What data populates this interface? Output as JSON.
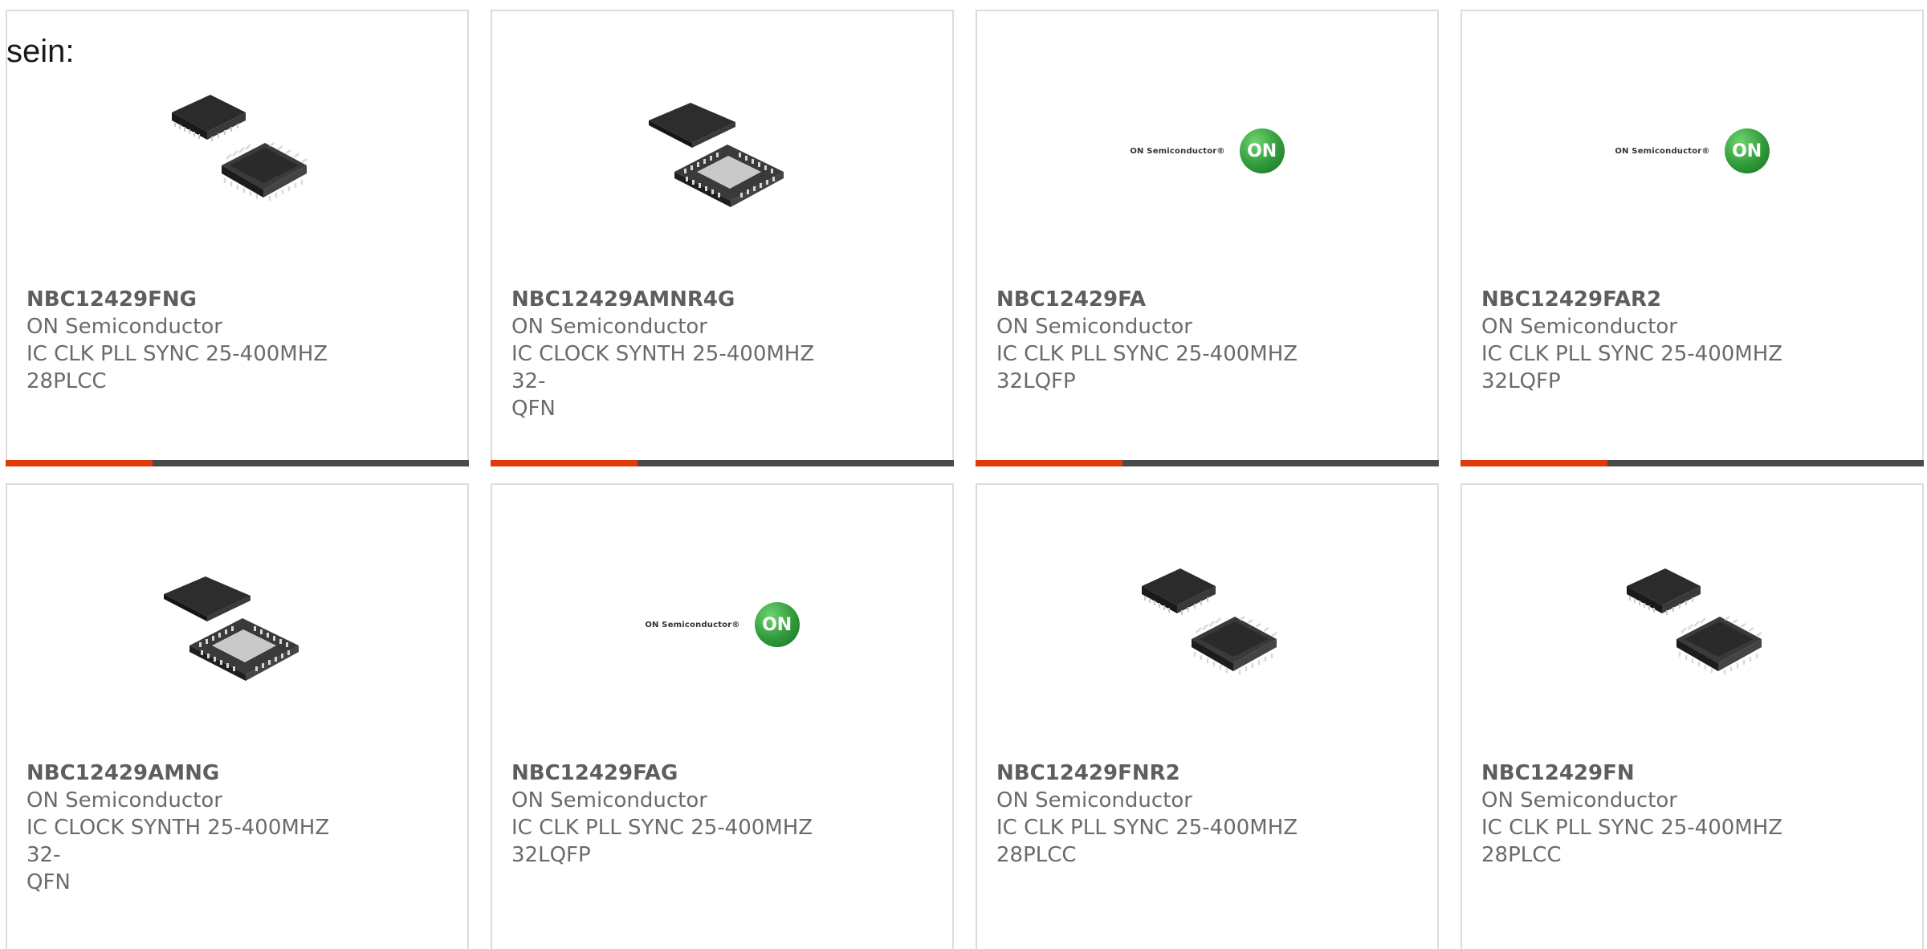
{
  "intro_text": "sein:",
  "products": [
    {
      "part": "NBC12429FNG",
      "manufacturer": "ON Semiconductor",
      "desc_line1": "IC CLK PLL SYNC 25-400MHZ",
      "desc_line2": "28PLCC",
      "image": "plcc-package"
    },
    {
      "part": "NBC12429AMNR4G",
      "manufacturer": "ON Semiconductor",
      "desc_line1": "IC CLOCK SYNTH 25-400MHZ 32-",
      "desc_line2": "QFN",
      "image": "qfn-package"
    },
    {
      "part": "NBC12429FA",
      "manufacturer": "ON Semiconductor",
      "desc_line1": "IC CLK PLL SYNC 25-400MHZ",
      "desc_line2": "32LQFP",
      "image": "on-semiconductor-logo"
    },
    {
      "part": "NBC12429FAR2",
      "manufacturer": "ON Semiconductor",
      "desc_line1": "IC CLK PLL SYNC 25-400MHZ",
      "desc_line2": "32LQFP",
      "image": "on-semiconductor-logo"
    },
    {
      "part": "NBC12429AMNG",
      "manufacturer": "ON Semiconductor",
      "desc_line1": "IC CLOCK SYNTH 25-400MHZ 32-",
      "desc_line2": "QFN",
      "image": "qfn-package"
    },
    {
      "part": "NBC12429FAG",
      "manufacturer": "ON Semiconductor",
      "desc_line1": "IC CLK PLL SYNC 25-400MHZ",
      "desc_line2": "32LQFP",
      "image": "on-semiconductor-logo"
    },
    {
      "part": "NBC12429FNR2",
      "manufacturer": "ON Semiconductor",
      "desc_line1": "IC CLK PLL SYNC 25-400MHZ",
      "desc_line2": "28PLCC",
      "image": "plcc-package"
    },
    {
      "part": "NBC12429FN",
      "manufacturer": "ON Semiconductor",
      "desc_line1": "IC CLK PLL SYNC 25-400MHZ",
      "desc_line2": "28PLCC",
      "image": "plcc-package"
    }
  ],
  "logo": {
    "text": "ON Semiconductor®",
    "mark": "ON"
  },
  "colors": {
    "accent": "#e03a0b",
    "bar": "#4a4a4a",
    "logo_green": "#2f9a3a"
  }
}
